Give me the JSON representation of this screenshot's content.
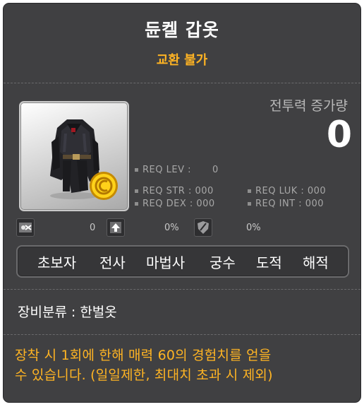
{
  "item": {
    "name": "듄켈 갑옷",
    "trade": "교환 불가"
  },
  "combat": {
    "label": "전투력 증가량",
    "value": "0"
  },
  "requirements": {
    "lev": "REQ LEV :",
    "lev_value": "0",
    "str": "REQ STR : 000",
    "luk": "REQ LUK : 000",
    "dex": "REQ DEX : 000",
    "int": "REQ INT : 000"
  },
  "stats": {
    "first_value": "0",
    "second_value": "0%",
    "third_value": "0%"
  },
  "jobs": [
    "초보자",
    "전사",
    "마법사",
    "궁수",
    "도적",
    "해적"
  ],
  "category": {
    "label": "장비분류",
    "separator": ":",
    "value": "한벌옷"
  },
  "description": {
    "line1": "장착 시 1회에 한해 매력 60의 경험치를 얻을",
    "line2": "수 있습니다. (일일제한, 최대치 초과 시 제외)"
  },
  "colors": {
    "background": "#404042",
    "accent_orange": "#ffb423",
    "text_white": "#ffffff",
    "text_gray": "#a7a7a7"
  },
  "icons": [
    "armor-item-icon",
    "gold-coin-icon",
    "scissors-icon",
    "upgrade-icon",
    "shield-slash-icon"
  ]
}
